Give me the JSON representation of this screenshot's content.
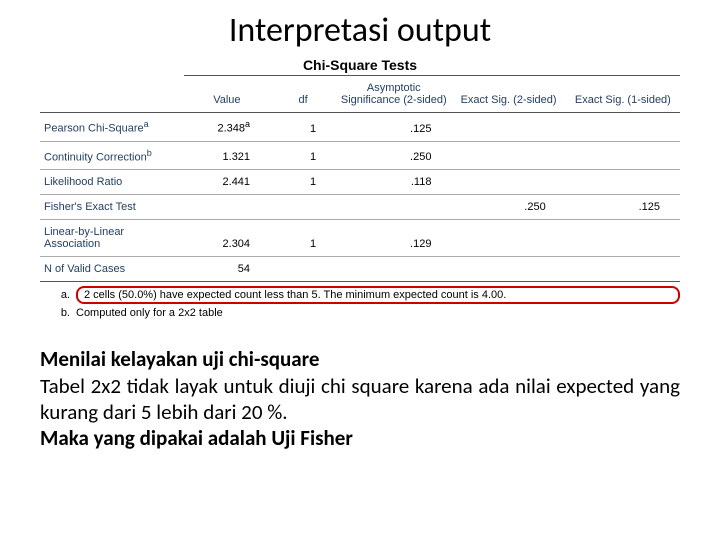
{
  "title": "Interpretasi output",
  "table_title": "Chi-Square Tests",
  "columns": [
    "",
    "Value",
    "df",
    "Asymptotic Significance (2-sided)",
    "Exact Sig. (2-sided)",
    "Exact Sig. (1-sided)"
  ],
  "rows": [
    {
      "label": "Pearson Chi-Square",
      "sup": "a",
      "value": "2.348",
      "valsup": "a",
      "df": "1",
      "asymp": ".125",
      "ex2": "",
      "ex1": ""
    },
    {
      "label": "Continuity Correction",
      "sup": "b",
      "value": "1.321",
      "valsup": "",
      "df": "1",
      "asymp": ".250",
      "ex2": "",
      "ex1": ""
    },
    {
      "label": "Likelihood Ratio",
      "sup": "",
      "value": "2.441",
      "valsup": "",
      "df": "1",
      "asymp": ".118",
      "ex2": "",
      "ex1": ""
    },
    {
      "label": "Fisher's Exact Test",
      "sup": "",
      "value": "",
      "valsup": "",
      "df": "",
      "asymp": "",
      "ex2": ".250",
      "ex1": ".125"
    },
    {
      "label": "Linear-by-Linear Association",
      "sup": "",
      "value": "2.304",
      "valsup": "",
      "df": "1",
      "asymp": ".129",
      "ex2": "",
      "ex1": ""
    },
    {
      "label": "N of Valid Cases",
      "sup": "",
      "value": "54",
      "valsup": "",
      "df": "",
      "asymp": "",
      "ex2": "",
      "ex1": ""
    }
  ],
  "footnote_a_mark": "a.",
  "footnote_a": "2 cells (50.0%) have expected count less than 5. The minimum expected count is 4.00.",
  "footnote_b_mark": "b.",
  "footnote_b": "Computed only for a 2x2 table",
  "body_sub": "Menilai kelayakan uji chi-square",
  "body_p1": "Tabel 2x2 tidak layak untuk diuji chi square karena ada nilai expected yang kurang dari 5 lebih dari 20 %.",
  "body_p2": "Maka yang dipakai adalah Uji Fisher",
  "chart_data": {
    "type": "table",
    "title": "Chi-Square Tests",
    "columns": [
      "Test",
      "Value",
      "df",
      "Asymptotic Significance (2-sided)",
      "Exact Sig. (2-sided)",
      "Exact Sig. (1-sided)"
    ],
    "rows": [
      [
        "Pearson Chi-Square",
        2.348,
        1,
        0.125,
        null,
        null
      ],
      [
        "Continuity Correction",
        1.321,
        1,
        0.25,
        null,
        null
      ],
      [
        "Likelihood Ratio",
        2.441,
        1,
        0.118,
        null,
        null
      ],
      [
        "Fisher's Exact Test",
        null,
        null,
        null,
        0.25,
        0.125
      ],
      [
        "Linear-by-Linear Association",
        2.304,
        1,
        0.129,
        null,
        null
      ],
      [
        "N of Valid Cases",
        54,
        null,
        null,
        null,
        null
      ]
    ],
    "footnotes": {
      "a": "2 cells (50.0%) have expected count less than 5. The minimum expected count is 4.00.",
      "b": "Computed only for a 2x2 table"
    }
  }
}
